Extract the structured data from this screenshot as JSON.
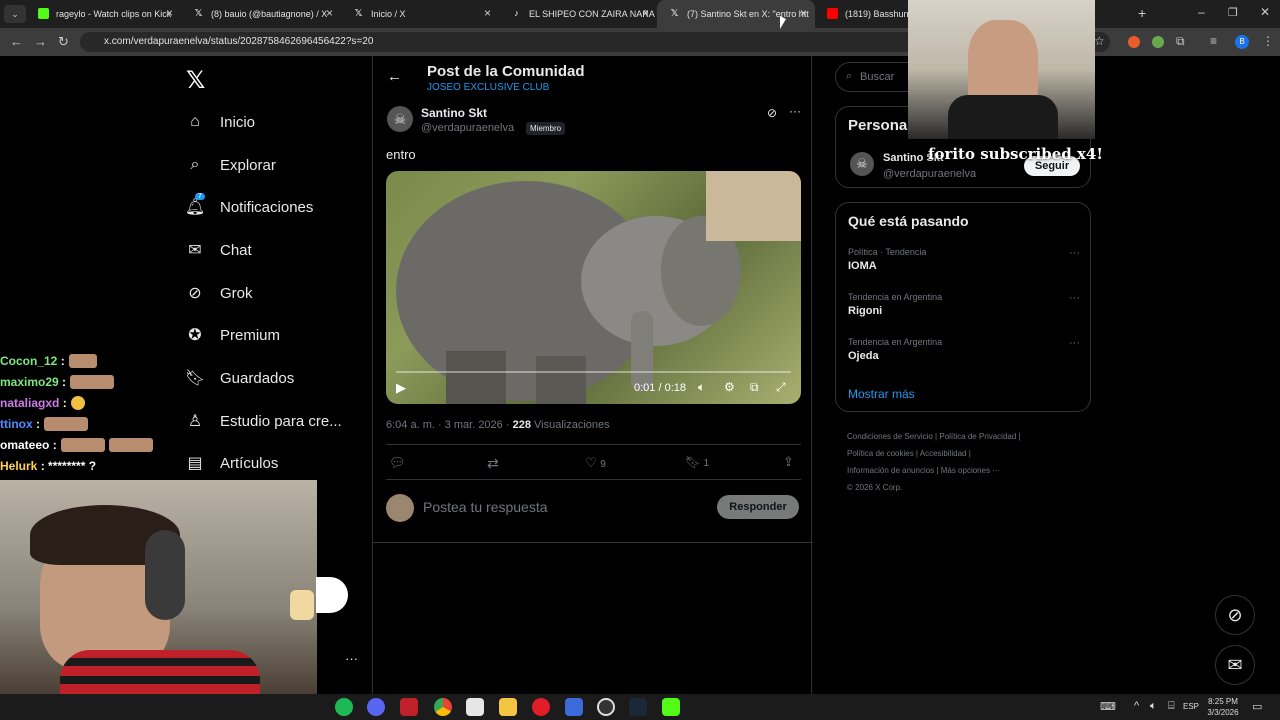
{
  "browser": {
    "tabs": [
      {
        "label": "rageylo - Watch clips on Kick",
        "color": "#53fc18"
      },
      {
        "label": "(8) bauio (@bautiagnone) / X",
        "color": "#000000"
      },
      {
        "label": "Inicio / X",
        "color": "#000000"
      },
      {
        "label": "EL SHIPEO CON ZAIRA NARA #",
        "color": "#000000"
      },
      {
        "label": "(7) Santino Skt en X: \"entro htt",
        "color": "#000000"
      },
      {
        "label": "(1819) Basshunter D",
        "color": "#ff0000"
      }
    ],
    "url": "x.com/verdapuraenelva/status/2028758462696456422?s=20"
  },
  "nav": {
    "items": [
      {
        "label": "Inicio",
        "icon": "home-icon"
      },
      {
        "label": "Explorar",
        "icon": "search-icon"
      },
      {
        "label": "Notificaciones",
        "icon": "bell-icon",
        "badge": "7"
      },
      {
        "label": "Chat",
        "icon": "mail-icon"
      },
      {
        "label": "Grok",
        "icon": "grok-icon"
      },
      {
        "label": "Premium",
        "icon": "verified-icon"
      },
      {
        "label": "Guardados",
        "icon": "bookmark-icon"
      },
      {
        "label": "Estudio para cre...",
        "icon": "studio-icon"
      },
      {
        "label": "Artículos",
        "icon": "article-icon"
      }
    ]
  },
  "post": {
    "header_title": "Post de la Comunidad",
    "community": "JOSEO EXCLUSIVE CLUB",
    "author_name": "Santino Skt",
    "author_handle": "@verdapuraenelva",
    "member_badge": "Miembro",
    "text": "entro",
    "video_time": "0:01 / 0:18",
    "timestamp": "6:04 a. m. · 3 mar. 2026 ·",
    "views_count": "228",
    "views_label": "Visualizaciones",
    "likes": "9",
    "bookmarks": "1",
    "reply_placeholder": "Postea tu respuesta",
    "reply_button": "Responder"
  },
  "sidebar": {
    "search_placeholder": "Buscar",
    "people_title": "Personas",
    "person_name": "Santino Skt",
    "person_handle": "@verdapuraenelva",
    "follow_label": "Seguir",
    "trends_title": "Qué está pasando",
    "trends": [
      {
        "context": "Política · Tendencia",
        "name": "IOMA"
      },
      {
        "context": "Tendencia en Argentina",
        "name": "Rigoni"
      },
      {
        "context": "Tendencia en Argentina",
        "name": "Ojeda"
      }
    ],
    "show_more": "Mostrar más",
    "footer_links": [
      "Condiciones de Servicio",
      "Política de Privacidad",
      "Política de cookies",
      "Accesibilidad",
      "Información de anuncios",
      "Más opciones ···",
      "© 2026 X Corp."
    ]
  },
  "overlay": {
    "sub_alert": "forito subscribed x4!"
  },
  "chat": {
    "lines": [
      {
        "user": "Cocon_12",
        "color": "#7ee87e",
        "msg": ""
      },
      {
        "user": "maximo29",
        "color": "#7ee87e",
        "msg": ""
      },
      {
        "user": "nataliagxd",
        "color": "#d07ce8",
        "msg": ""
      },
      {
        "user": "ttinox",
        "color": "#4f8cff",
        "msg": ""
      },
      {
        "user": "omateeo",
        "color": "#ffffff",
        "msg": ""
      },
      {
        "user": "Helurk",
        "color": "#ffd24d",
        "msg": "******** ?"
      }
    ]
  },
  "system": {
    "lang": "ESP",
    "time": "8:25 PM",
    "date": "3/3/2026"
  },
  "colors": {
    "accent": "#1d9bf0",
    "bg": "#000000",
    "border": "#2f3336"
  }
}
